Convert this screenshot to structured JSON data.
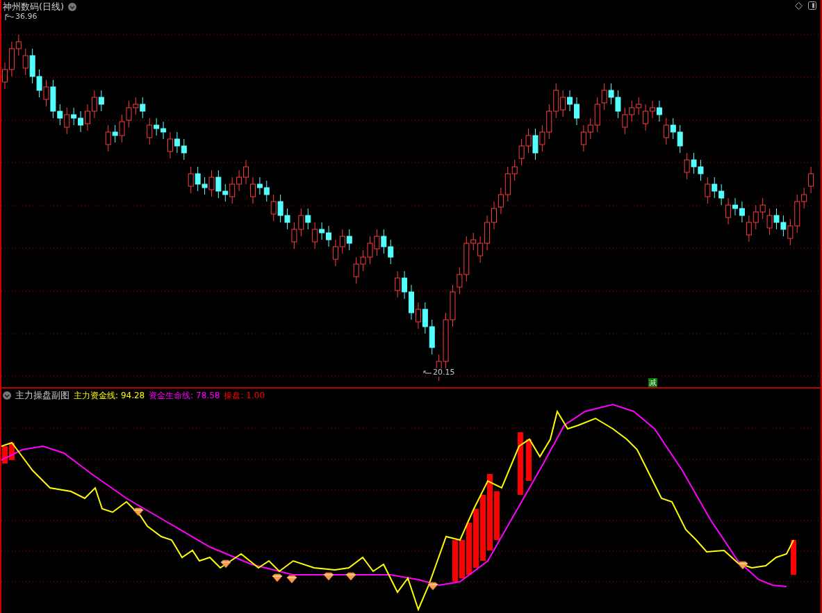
{
  "price_pane": {
    "title": "神州数码(日线)",
    "high_label": "36.96",
    "low_label": "20.15",
    "signal_tag": "减"
  },
  "indicator_pane": {
    "name": "主力操盘副图",
    "legend": [
      {
        "label": "主力资金线:",
        "value": "94.28",
        "color": "#ffff00"
      },
      {
        "label": "资金生命线:",
        "value": "78.58",
        "color": "#ff00ff"
      },
      {
        "label": "操盘:",
        "value": "1.00",
        "color": "#ff0000"
      }
    ]
  }
}
